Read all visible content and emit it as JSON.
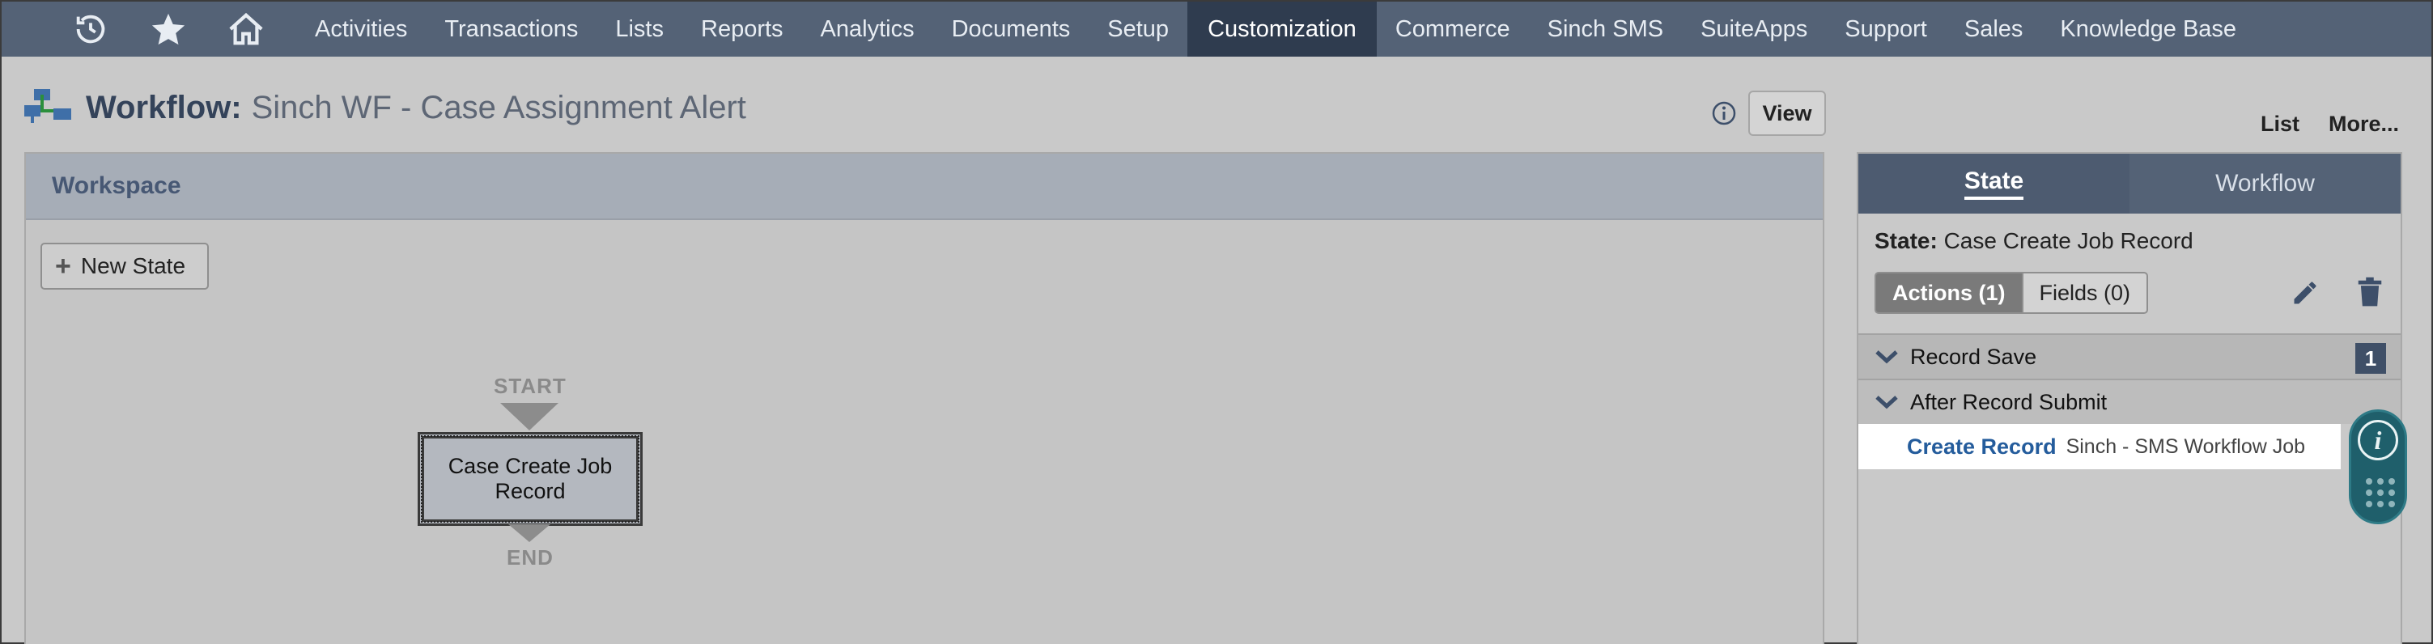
{
  "nav": {
    "icons": [
      "recent-history-icon",
      "star-icon",
      "home-icon"
    ],
    "items": [
      {
        "label": "Activities"
      },
      {
        "label": "Transactions"
      },
      {
        "label": "Lists"
      },
      {
        "label": "Reports"
      },
      {
        "label": "Analytics"
      },
      {
        "label": "Documents"
      },
      {
        "label": "Setup"
      },
      {
        "label": "Customization",
        "active": true
      },
      {
        "label": "Commerce"
      },
      {
        "label": "Sinch SMS"
      },
      {
        "label": "SuiteApps"
      },
      {
        "label": "Support"
      },
      {
        "label": "Sales"
      },
      {
        "label": "Knowledge Base"
      }
    ]
  },
  "page": {
    "title_label": "Workflow:",
    "title_name": "Sinch WF - Case Assignment Alert",
    "view_button": "View",
    "links": {
      "list": "List",
      "more": "More..."
    }
  },
  "workspace": {
    "header": "Workspace",
    "new_state_button": "New State",
    "start_label": "START",
    "end_label": "END",
    "state_node": "Case Create Job Record"
  },
  "side_panel": {
    "tabs": {
      "state": "State",
      "workflow": "Workflow"
    },
    "active_tab": "State",
    "state_title_label": "State:",
    "state_title_value": "Case Create Job Record",
    "segments": {
      "actions": "Actions (1)",
      "fields": "Fields (0)"
    },
    "triggers": [
      {
        "label": "Record Save",
        "count": "1"
      },
      {
        "label": "After Record Submit"
      }
    ],
    "action": {
      "type": "Create Record",
      "target": "Sinch - SMS Workflow Job"
    }
  },
  "colors": {
    "nav_bg": "#546276",
    "nav_active_bg": "#2f3c4f",
    "page_bg": "#c9c9c9",
    "title_color": "#34435a",
    "link_blue": "#245c9c",
    "help_widget": "#1f5f6b"
  }
}
